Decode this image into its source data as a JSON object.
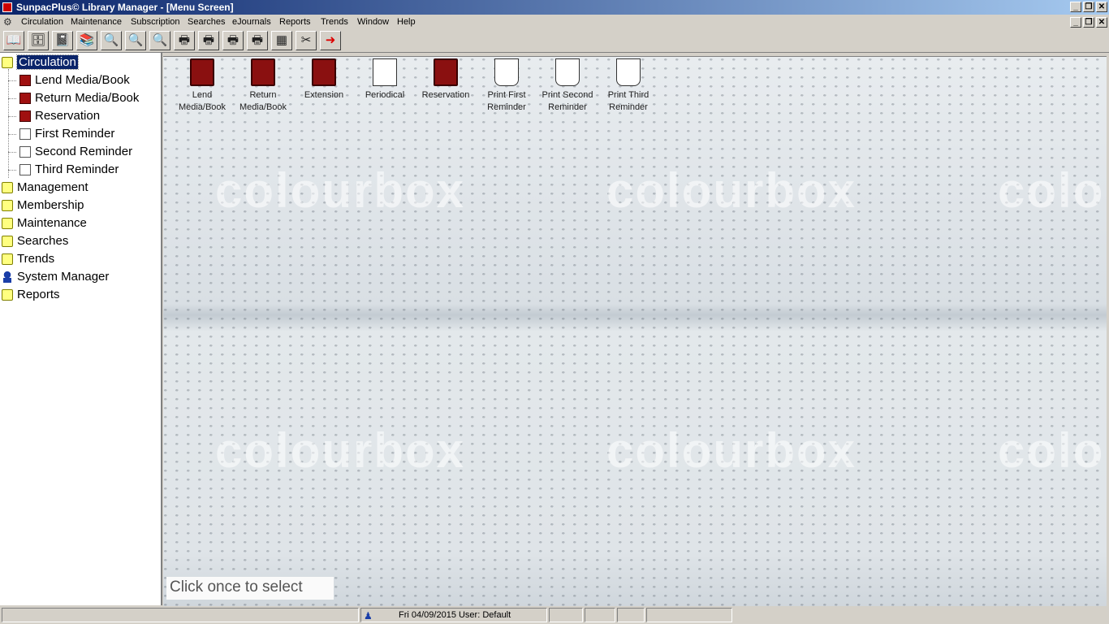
{
  "window": {
    "title": "SunpacPlus© Library Manager - [Menu Screen]"
  },
  "menubar": {
    "items": [
      "Circulation",
      "Maintenance",
      "Subscription",
      "Searches",
      "eJournals",
      "Reports",
      "Trends",
      "Window",
      "Help"
    ]
  },
  "toolbar": {
    "buttons": [
      "lend-icon",
      "return-icon",
      "book-icon",
      "books-icon",
      "search-icon",
      "search-icon",
      "search-icon",
      "printer-icon",
      "printer-icon",
      "printer-icon",
      "printer-icon",
      "calculator-icon",
      "tools-icon",
      "exit-icon"
    ]
  },
  "tree": {
    "items": [
      {
        "label": "Circulation",
        "icon": "folder-icon",
        "selected": true
      },
      {
        "label": "Lend Media/Book",
        "icon": "book-icon"
      },
      {
        "label": "Return Media/Book",
        "icon": "book-icon"
      },
      {
        "label": "Reservation",
        "icon": "book-icon"
      },
      {
        "label": "First Reminder",
        "icon": "printer-icon"
      },
      {
        "label": "Second Reminder",
        "icon": "printer-icon"
      },
      {
        "label": "Third Reminder",
        "icon": "printer-icon"
      },
      {
        "label": "Management",
        "icon": "folder-icon"
      },
      {
        "label": "Membership",
        "icon": "folder-icon"
      },
      {
        "label": "Maintenance",
        "icon": "folder-icon"
      },
      {
        "label": "Searches",
        "icon": "folder-icon"
      },
      {
        "label": "Trends",
        "icon": "folder-icon"
      },
      {
        "label": "System Manager",
        "icon": "user-icon"
      },
      {
        "label": "Reports",
        "icon": "folder-icon"
      }
    ]
  },
  "main": {
    "watermark": "colourbox",
    "launchers": [
      {
        "line1": "Lend",
        "line2": "Media/Book",
        "icon": "book-icon"
      },
      {
        "line1": "Return",
        "line2": "Media/Book",
        "icon": "book-icon"
      },
      {
        "line1": "Extension",
        "line2": "",
        "icon": "book-icon"
      },
      {
        "line1": "Periodical",
        "line2": "",
        "icon": "paper-icon"
      },
      {
        "line1": "Reservation",
        "line2": "",
        "icon": "book-icon"
      },
      {
        "line1": "Print First",
        "line2": "Reminder",
        "icon": "printer-icon"
      },
      {
        "line1": "Print Second",
        "line2": "Reminder",
        "icon": "printer-icon"
      },
      {
        "line1": "Print Third",
        "line2": "Reminder",
        "icon": "printer-icon"
      }
    ],
    "hint": "Click once to select"
  },
  "statusbar": {
    "datetime_user": "Fri 04/09/2015 User: Default"
  }
}
